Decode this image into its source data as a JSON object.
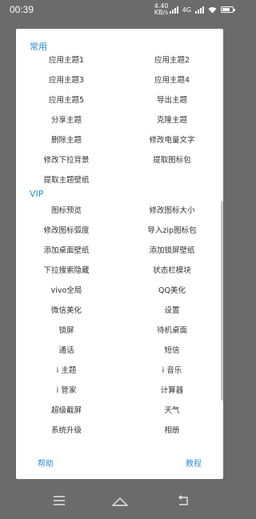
{
  "statusbar": {
    "time": "00:39",
    "network_speed": "4.40 KB/s",
    "network_type": "4G"
  },
  "dialog": {
    "common_title": "常用",
    "common_items": [
      "应用主题1",
      "应用主题2",
      "应用主题3",
      "应用主题4",
      "应用主题5",
      "导出主题",
      "分享主题",
      "克隆主题",
      "删除主题",
      "修改电量文字",
      "修改下拉背景",
      "提取图标包",
      "提取主题壁纸"
    ],
    "vip_title": "VIP",
    "vip_items": [
      "图标预览",
      "修改图标大小",
      "修改图标弧度",
      "导入zip图标包",
      "添加桌面壁纸",
      "添加锁屏壁纸",
      "下拉搜索隐藏",
      "状态栏模块",
      "vivo全局",
      "QQ美化",
      "微信美化",
      "设置",
      "锁屏",
      "待机桌面",
      "通话",
      "短信",
      "i 主题",
      "i 音乐",
      "i 管家",
      "计算器",
      "超级截屏",
      "天气",
      "系统升级",
      "相册"
    ],
    "help_label": "帮助",
    "tutorial_label": "教程"
  },
  "navbar": {
    "icons": [
      "menu-icon",
      "home-icon",
      "back-icon"
    ]
  },
  "colors": {
    "accent": "#2e8fd6",
    "overlay": "#6b6b6b",
    "dialog_bg": "#ffffff",
    "text": "#333333"
  }
}
